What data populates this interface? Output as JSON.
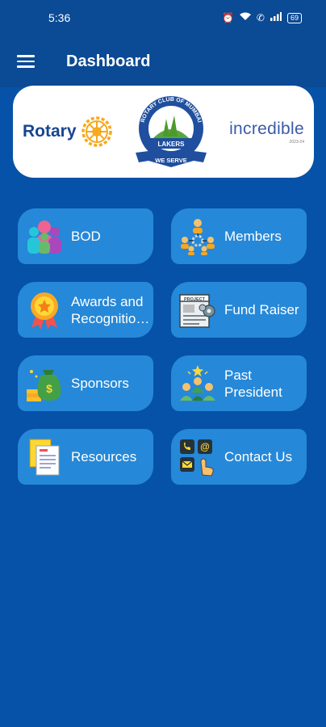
{
  "status_bar": {
    "time": "5:36",
    "battery": "69"
  },
  "app_bar": {
    "title": "Dashboard",
    "menu_icon": "menu-icon"
  },
  "banner": {
    "left_logo_text": "Rotary",
    "center_emblem_top": "ROTARY CLUB OF MUMBAI",
    "center_emblem_middle": "LAKERS",
    "center_emblem_ribbon": "WE SERVE",
    "right_logo_text": "incredible",
    "right_logo_year": "2023-24"
  },
  "tiles": [
    {
      "label": "BOD",
      "icon": "group-people-icon"
    },
    {
      "label": "Members",
      "icon": "org-network-icon"
    },
    {
      "label": "Awards and Recognitio…",
      "icon": "award-medal-icon"
    },
    {
      "label": "Fund Raiser",
      "icon": "project-document-icon"
    },
    {
      "label": "Sponsors",
      "icon": "money-bag-icon"
    },
    {
      "label": "Past President",
      "icon": "leader-star-icon"
    },
    {
      "label": "Resources",
      "icon": "documents-icon"
    },
    {
      "label": "Contact Us",
      "icon": "contact-touch-icon"
    }
  ],
  "colors": {
    "background": "#0652a8",
    "app_bar": "#0b4a94",
    "tile": "#2688d8",
    "rotary_blue": "#17458f",
    "rotary_gold": "#f7a81b"
  }
}
